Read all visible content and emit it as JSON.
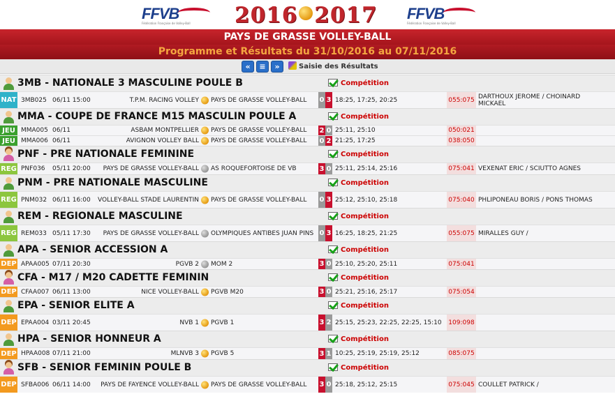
{
  "header": {
    "logo_left": "FFVB",
    "logo_right": "FFVB",
    "logo_subtitle": "Fédération Française de Volley-Ball",
    "year_start": "2016",
    "year_end": "2017",
    "club": "PAYS DE GRASSE VOLLEY-BALL",
    "programme": "Programme et Résultats du 31/10/2016 au 07/11/2016"
  },
  "nav": {
    "prev": "«",
    "list": "≡",
    "next": "»",
    "saisie": "Saisie des Résultats"
  },
  "colors": {
    "NAT": "#2fb2c9",
    "JEU": "#3aa02e",
    "REG": "#8cc63e",
    "DEP": "#f39a1f",
    "win": "#c8102e",
    "lose": "#9a9a9a"
  },
  "competition_label": "Compétition",
  "sections": [
    {
      "title": "3MB - NATIONALE 3 MASCULINE POULE B",
      "gender": "m",
      "rows": [
        {
          "lvl": "NAT",
          "code": "3MB025",
          "date": "06/11 15:00",
          "home": "T.P.M. RACING VOLLEY",
          "away": "PAYS DE GRASSE VOLLEY-BALL",
          "s1": "0",
          "s2": "3",
          "sets": "18:25, 17:25, 20:25",
          "pts": "055:075",
          "refs": "DARTHOUX JEROME / CHOINARD MICKAEL",
          "h": 24
        }
      ]
    },
    {
      "title": "MMA - COUPE DE FRANCE M15 MASCULIN POULE A",
      "gender": "m",
      "rows": [
        {
          "lvl": "JEU",
          "code": "MMA005",
          "date": "06/11",
          "home": "ASBAM MONTPELLIER",
          "away": "PAYS DE GRASSE VOLLEY-BALL",
          "s1": "2",
          "s2": "0",
          "sets": "25:11, 25:10",
          "pts": "050:021",
          "refs": "",
          "h": 15
        },
        {
          "lvl": "JEU",
          "code": "MMA006",
          "date": "06/11",
          "home": "AVIGNON VOLLEY BALL",
          "away": "PAYS DE GRASSE VOLLEY-BALL",
          "s1": "0",
          "s2": "2",
          "sets": "21:25, 17:25",
          "pts": "038:050",
          "refs": "",
          "h": 15
        }
      ]
    },
    {
      "title": "PNF - PRE NATIONALE FEMININE",
      "gender": "f",
      "rows": [
        {
          "lvl": "REG",
          "code": "PNF036",
          "date": "05/11 20:00",
          "home": "PAYS DE GRASSE VOLLEY-BALL",
          "away": "AS ROQUEFORTOISE DE VB",
          "s1": "3",
          "s2": "0",
          "sets": "25:11, 25:14, 25:16",
          "pts": "075:041",
          "refs": "VEXENAT ERIC / SCIUTTO AGNES",
          "h": 17
        }
      ]
    },
    {
      "title": "PNM - PRE NATIONALE MASCULINE",
      "gender": "m",
      "rows": [
        {
          "lvl": "REG",
          "code": "PNM032",
          "date": "06/11 16:00",
          "home": "VOLLEY-BALL STADE LAURENTIN",
          "away": "PAYS DE GRASSE VOLLEY-BALL",
          "s1": "0",
          "s2": "3",
          "sets": "25:12, 25:10, 25:18",
          "pts": "075:040",
          "refs": "PHLIPONEAU BORIS / PONS THOMAS",
          "h": 24
        }
      ]
    },
    {
      "title": "REM - REGIONALE MASCULINE",
      "gender": "m",
      "rows": [
        {
          "lvl": "REG",
          "code": "REM033",
          "date": "05/11 17:30",
          "home": "PAYS DE GRASSE VOLLEY-BALL",
          "away": "OLYMPIQUES ANTIBES JUAN PINS",
          "s1": "0",
          "s2": "3",
          "sets": "16:25, 18:25, 21:25",
          "pts": "055:075",
          "refs": "MIRALLES GUY /",
          "h": 24
        }
      ]
    },
    {
      "title": "APA - SENIOR ACCESSION A",
      "gender": "m",
      "rows": [
        {
          "lvl": "DEP",
          "code": "APAA005",
          "date": "07/11 20:30",
          "home": "PGVB 2",
          "away": "MOM 2",
          "s1": "3",
          "s2": "0",
          "sets": "25:10, 25:20, 25:11",
          "pts": "075:041",
          "refs": "",
          "h": 16
        }
      ]
    },
    {
      "title": "CFA - M17 / M20 CADETTE FEMININ",
      "gender": "f",
      "rows": [
        {
          "lvl": "DEP",
          "code": "CFAA007",
          "date": "06/11 13:00",
          "home": "NICE VOLLEY-BALL",
          "away": "PGVB M20",
          "s1": "3",
          "s2": "0",
          "sets": "25:21, 25:16, 25:17",
          "pts": "075:054",
          "refs": "",
          "h": 16
        }
      ]
    },
    {
      "title": "EPA - SENIOR ELITE A",
      "gender": "m",
      "rows": [
        {
          "lvl": "DEP",
          "code": "EPAA004",
          "date": "03/11 20:45",
          "home": "NVB 1",
          "away": "PGVB 1",
          "s1": "3",
          "s2": "2",
          "sets": "25:15, 25:23, 22:25, 22:25, 15:10",
          "pts": "109:098",
          "refs": "",
          "h": 24
        }
      ]
    },
    {
      "title": "HPA - SENIOR HONNEUR A",
      "gender": "m",
      "rows": [
        {
          "lvl": "DEP",
          "code": "HPAA008",
          "date": "07/11 21:00",
          "home": "MLNVB 3",
          "away": "PGVB 5",
          "s1": "3",
          "s2": "1",
          "sets": "10:25, 25:19, 25:19, 25:12",
          "pts": "085:075",
          "refs": "",
          "h": 17
        }
      ]
    },
    {
      "title": "SFB - SENIOR FEMININ POULE B",
      "gender": "f",
      "rows": [
        {
          "lvl": "DEP",
          "code": "SFBA006",
          "date": "06/11 14:00",
          "home": "PAYS DE FAYENCE VOLLEY-BALL",
          "away": "PAYS DE GRASSE VOLLEY-BALL",
          "s1": "3",
          "s2": "0",
          "sets": "25:18, 25:12, 25:15",
          "pts": "075:045",
          "refs": "COULLET PATRICK /",
          "h": 24
        }
      ]
    }
  ]
}
